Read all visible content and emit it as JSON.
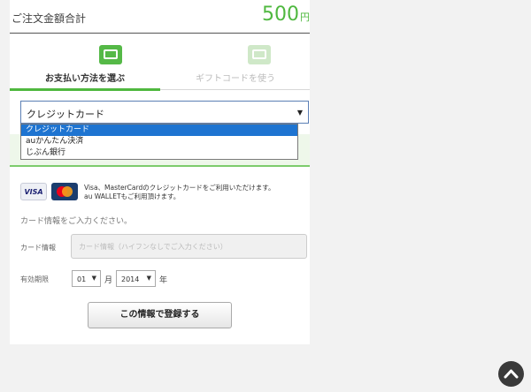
{
  "order": {
    "label": "ご注文金額合計",
    "amount": "500",
    "currency": "円"
  },
  "tabs": [
    {
      "label": "お支払い方法を選ぶ",
      "icon": "card-payment-icon",
      "active": true
    },
    {
      "label": "ギフトコードを使う",
      "icon": "gift-code-icon",
      "active": false
    }
  ],
  "payment_select": {
    "value": "クレジットカード",
    "options": [
      "クレジットカード",
      "auかんたん決済",
      "じぶん銀行"
    ],
    "selected_index": 0
  },
  "cards": {
    "visa_label": "VISA",
    "note_line1": "Visa、MasterCardのクレジットカードをご利用いただけます。",
    "note_line2": "au WALLETもご利用頂けます。"
  },
  "form": {
    "hint": "カード情報をご入力ください。",
    "card_label": "カード情報",
    "card_placeholder": "カード情報（ハイフンなしでご入力ください）",
    "expiry_label": "有効期限",
    "month_value": "01",
    "month_unit": "月",
    "year_value": "2014",
    "year_unit": "年",
    "submit_label": "この情報で登録する"
  },
  "colors": {
    "accent": "#4fb83f",
    "dropdown_selected": "#1e74d1"
  }
}
